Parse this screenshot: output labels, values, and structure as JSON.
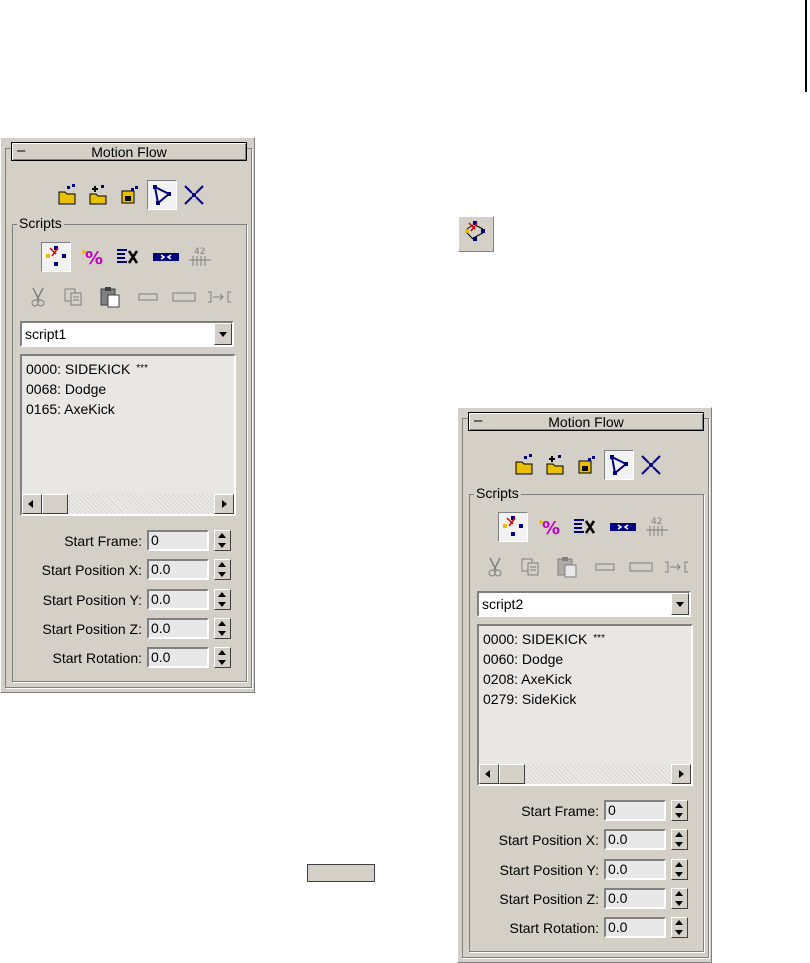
{
  "panels": [
    {
      "rollout_title": "Motion Flow",
      "group_label": "Scripts",
      "dropdown_value": "script1",
      "script_entries": [
        {
          "text": "0000: SIDEKICK",
          "stars": "***"
        },
        {
          "text": "0068: Dodge",
          "stars": ""
        },
        {
          "text": "0165: AxeKick",
          "stars": ""
        }
      ],
      "fields": [
        {
          "label": "Start Frame:",
          "value": "0"
        },
        {
          "label": "Start Position X:",
          "value": "0.0"
        },
        {
          "label": "Start Position Y:",
          "value": "0.0"
        },
        {
          "label": "Start Position Z:",
          "value": "0.0"
        },
        {
          "label": "Start Rotation:",
          "value": "0.0"
        }
      ]
    },
    {
      "rollout_title": "Motion Flow",
      "group_label": "Scripts",
      "dropdown_value": "script2",
      "script_entries": [
        {
          "text": "0000: SIDEKICK",
          "stars": "***"
        },
        {
          "text": "0060: Dodge",
          "stars": ""
        },
        {
          "text": "0208: AxeKick",
          "stars": ""
        },
        {
          "text": "0279: SideKick",
          "stars": ""
        }
      ],
      "fields": [
        {
          "label": "Start Frame:",
          "value": "0"
        },
        {
          "label": "Start Position X:",
          "value": "0.0"
        },
        {
          "label": "Start Position Y:",
          "value": "0.0"
        },
        {
          "label": "Start Position Z:",
          "value": "0.0"
        },
        {
          "label": "Start Rotation:",
          "value": "0.0"
        }
      ]
    }
  ],
  "rollout_collapse_symbol": "–",
  "icons": {
    "toolbar": [
      "load-file-icon",
      "append-file-icon",
      "save-file-icon",
      "show-graph-icon",
      "collapse-icon"
    ],
    "scripts_row1": [
      "define-script-icon",
      "transition-percent-icon",
      "delete-clip-icon",
      "insert-clip-icon",
      "set-range-icon"
    ],
    "scripts_row2": [
      "cut-icon",
      "copy-icon",
      "paste-icon",
      "flat-rect-icon",
      "rect-icon",
      "goto-frame-icon"
    ],
    "floating": "define-script-icon"
  },
  "colors": {
    "panel_bg": "#d4d0c8",
    "list_bg": "#e9e7e3",
    "accent_navy": "#000080",
    "accent_magenta": "#c000c0",
    "accent_yellow": "#e8c000"
  }
}
